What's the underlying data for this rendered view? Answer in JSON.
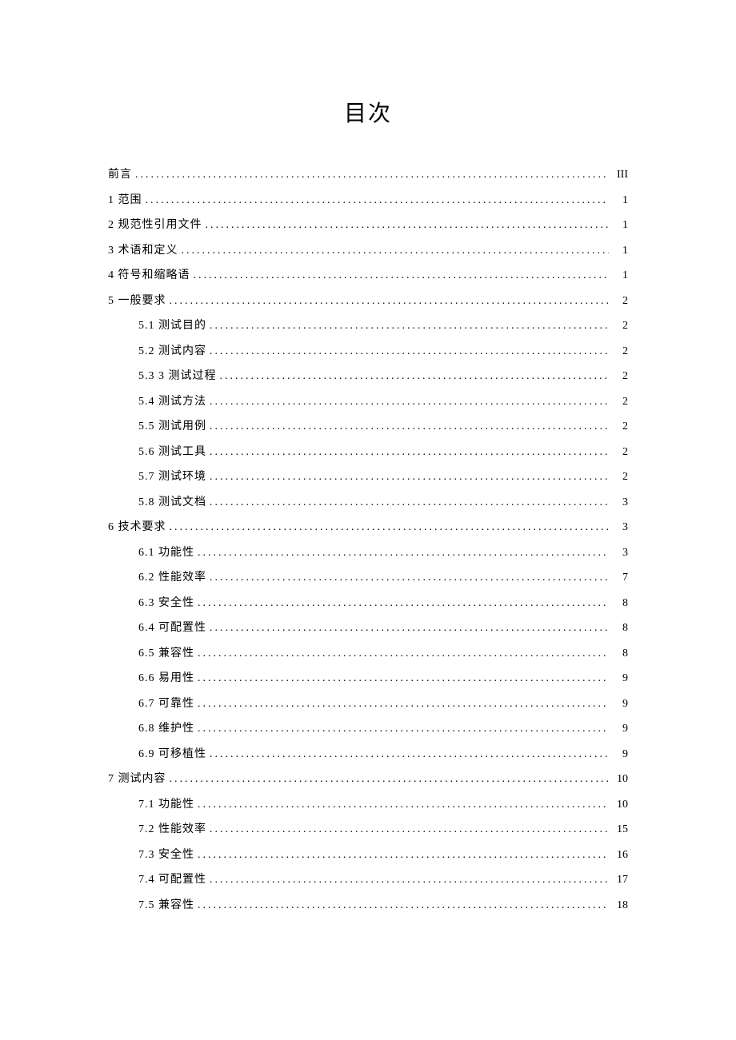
{
  "title": "目次",
  "entries": [
    {
      "level": 1,
      "label": "前言",
      "page": "III"
    },
    {
      "level": 1,
      "label": "1 范围",
      "page": "1"
    },
    {
      "level": 1,
      "label": "2 规范性引用文件",
      "page": "1"
    },
    {
      "level": 1,
      "label": "3 术语和定义",
      "page": "1"
    },
    {
      "level": 1,
      "label": "4 符号和缩略语",
      "page": "1"
    },
    {
      "level": 1,
      "label": "5 一般要求",
      "page": "2"
    },
    {
      "level": 2,
      "label": "5.1  测试目的",
      "page": "2"
    },
    {
      "level": 2,
      "label": "5.2  测试内容",
      "page": "2"
    },
    {
      "level": 2,
      "label": "5.3 3 测试过程",
      "page": "2"
    },
    {
      "level": 2,
      "label": "5.4  测试方法",
      "page": "2"
    },
    {
      "level": 2,
      "label": "5.5  测试用例",
      "page": "2"
    },
    {
      "level": 2,
      "label": "5.6 测试工具",
      "page": "2"
    },
    {
      "level": 2,
      "label": "5.7 测试环境",
      "page": "2"
    },
    {
      "level": 2,
      "label": "5.8 测试文档",
      "page": "3"
    },
    {
      "level": 1,
      "label": "6 技术要求",
      "page": "3"
    },
    {
      "level": 2,
      "label": "6.1 功能性",
      "page": "3"
    },
    {
      "level": 2,
      "label": "6.2 性能效率",
      "page": "7"
    },
    {
      "level": 2,
      "label": "6.3 安全性",
      "page": "8"
    },
    {
      "level": 2,
      "label": "6.4 可配置性",
      "page": "8"
    },
    {
      "level": 2,
      "label": "6.5 兼容性",
      "page": "8"
    },
    {
      "level": 2,
      "label": "6.6 易用性",
      "page": "9"
    },
    {
      "level": 2,
      "label": "6.7 可靠性",
      "page": "9"
    },
    {
      "level": 2,
      "label": "6.8 维护性",
      "page": "9"
    },
    {
      "level": 2,
      "label": "6.9 可移植性",
      "page": "9"
    },
    {
      "level": 1,
      "label": "7 测试内容",
      "page": "10"
    },
    {
      "level": 2,
      "label": "7.1 功能性",
      "page": "10"
    },
    {
      "level": 2,
      "label": "7.2 性能效率",
      "page": "15"
    },
    {
      "level": 2,
      "label": "7.3 安全性",
      "page": "16"
    },
    {
      "level": 2,
      "label": "7.4 可配置性",
      "page": "17"
    },
    {
      "level": 2,
      "label": "7.5 兼容性",
      "page": "18"
    }
  ]
}
